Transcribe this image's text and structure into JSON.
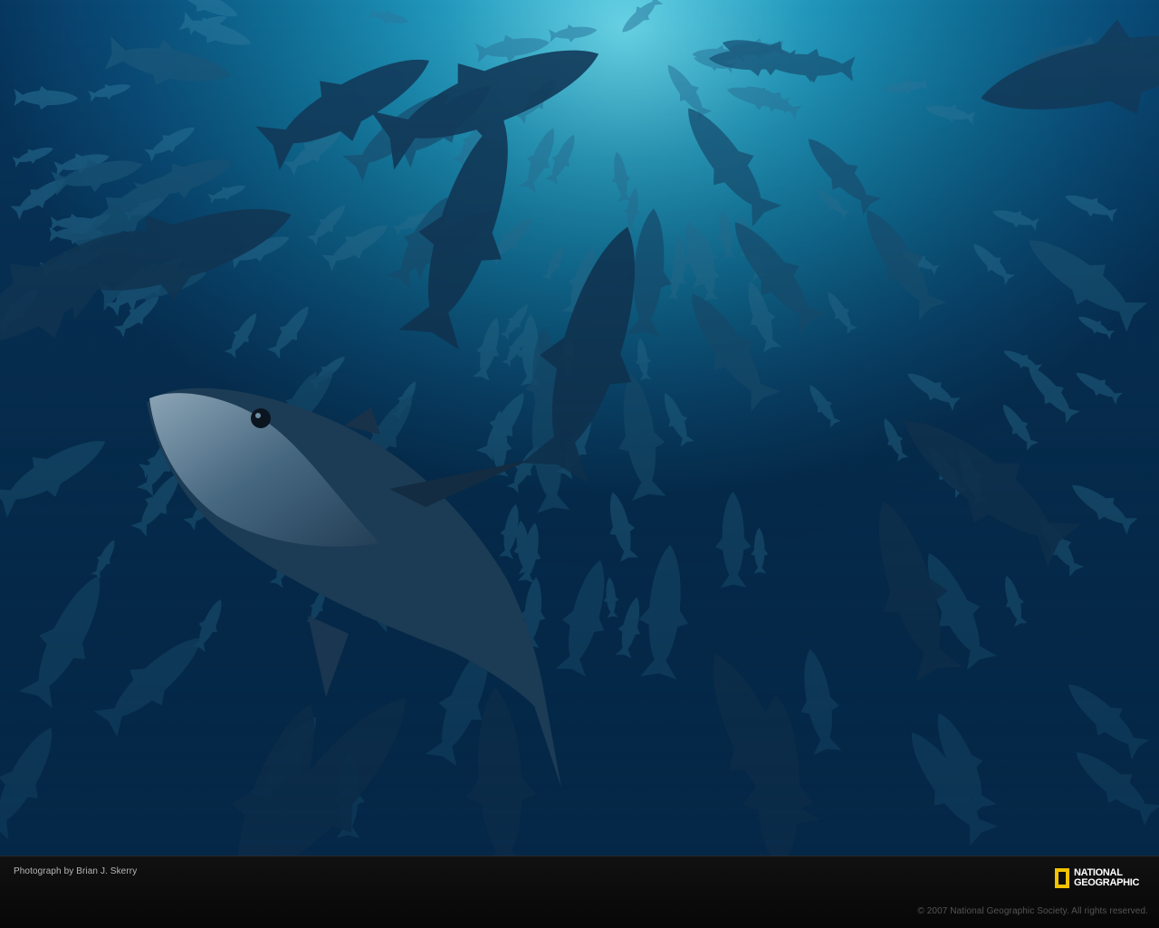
{
  "photo": {
    "subject": "school of tuna underwater",
    "colors": {
      "water_light": "#4fc6dd",
      "water_mid": "#0f6f99",
      "water_deep": "#07365e",
      "fish": "#123a58"
    }
  },
  "caption": {
    "credit": "Photograph by Brian J. Skerry",
    "copyright": "© 2007 National Geographic Society. All rights reserved."
  },
  "logo": {
    "line1": "NATIONAL",
    "line2": "GEOGRAPHIC",
    "frame_color": "#f2c200"
  }
}
